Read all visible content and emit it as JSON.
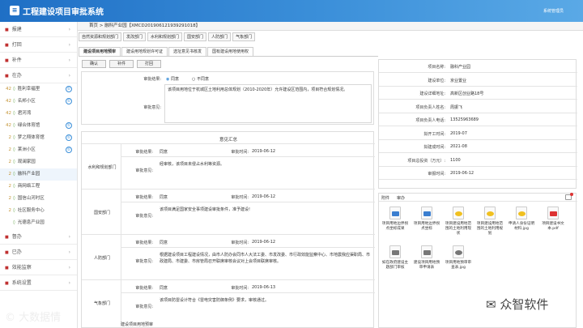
{
  "app": {
    "title": "工程建设项目审批系统",
    "logo": "≡",
    "user": "系统管理员"
  },
  "sidebar": {
    "items_top": [
      {
        "icon": "■",
        "label": "报建"
      },
      {
        "icon": "■",
        "label": "打回"
      },
      {
        "icon": "■",
        "label": "补件"
      },
      {
        "icon": "■",
        "label": "在办"
      }
    ],
    "sub": [
      {
        "n": "42",
        "label": "胜利幸福里",
        "badge": "①"
      },
      {
        "n": "42",
        "label": "名邦小区",
        "badge": "①"
      },
      {
        "n": "42",
        "label": "君河湾",
        "badge": ""
      },
      {
        "n": "42",
        "label": "绿合体育馆",
        "badge": "①"
      },
      {
        "n": "2",
        "label": "梦之翔体育馆",
        "badge": "①"
      },
      {
        "n": "2",
        "label": "莱洲小区",
        "badge": "①"
      },
      {
        "n": "2",
        "label": "观澜家园",
        "badge": ""
      },
      {
        "n": "2",
        "label": "融科产业园",
        "badge": ""
      },
      {
        "n": "2",
        "label": "商网络工程",
        "badge": ""
      },
      {
        "n": "2",
        "label": "国信山河时区",
        "badge": ""
      },
      {
        "n": "2",
        "label": "社区服务中心",
        "badge": ""
      },
      {
        "n": "",
        "label": "光德息产业园",
        "badge": ""
      }
    ],
    "items_bottom": [
      {
        "icon": "■",
        "label": "督办"
      },
      {
        "icon": "■",
        "label": "已办"
      },
      {
        "icon": "■",
        "label": "效能监察"
      },
      {
        "icon": "■",
        "label": "系统设置"
      }
    ]
  },
  "breadcrumb": "首页 > 融科产业园【XMCD20190612193929101​8】",
  "tabs": [
    "自然资源和规划部门",
    "发改部门",
    "水利和规划部门",
    "国安部门",
    "人防部门",
    "气象部门"
  ],
  "subtabs": [
    "建设项目用地预审",
    "建设用地规划许可证",
    "选址意见书核发",
    "国有建设用地使用权"
  ],
  "buttons": [
    "确认",
    "补件",
    "打回"
  ],
  "approval": {
    "result_label": "审批结果:",
    "opt_agree": "同意",
    "opt_disagree": "不同意",
    "opinion_label": "审批意见:",
    "opinion": "该项目用地位于杭城区土地利用总体规划（2010-2020年）允许建设区范围内，项目符合规划情况。"
  },
  "summary": {
    "title": "意见汇总",
    "rows": [
      {
        "dept": "水利和规划部门",
        "result": "同意",
        "date": "2019-06-12",
        "opinion": "经审核，该项目未侵占水利等资源。"
      },
      {
        "dept": "国安部门",
        "result": "同意",
        "date": "2019-06-12",
        "opinion": "该项目满足国家安全事项建设审批条件，准予建设!"
      },
      {
        "dept": "人防部门",
        "result": "同意",
        "date": "2019-06-12",
        "opinion": "根据建设项目工程建设情况，由市人防办会同市人大法工委、市发改委、市行政效能监察中心、市地震我应渠职局、市政建局、市建委、市房管局召开联席审核会议对上会项目联席审核。"
      },
      {
        "dept": "气象部门",
        "result": "同意",
        "date": "2019-06-13",
        "opinion": "该项目防雷设计符合《雷电灾害防御条例》要求，审核通过。"
      }
    ],
    "labels": {
      "result": "审批结果:",
      "date": "审批时间:",
      "opinion": "审批意见:"
    },
    "footer": "建设项目用地预审"
  },
  "info": [
    {
      "k": "项目名称:",
      "v": "融科产业园"
    },
    {
      "k": "建设单位:",
      "v": "京业置业"
    },
    {
      "k": "建设详细地址:",
      "v": "高新区创业路18号"
    },
    {
      "k": "项目负责人姓名:",
      "v": "周振飞"
    },
    {
      "k": "项目负责人电话:",
      "v": "13525963689"
    },
    {
      "k": "拟开工时间:",
      "v": "2019-07"
    },
    {
      "k": "拟建成时间:",
      "v": "2021-08"
    },
    {
      "k": "项目总投资（万元）:",
      "v": "1100"
    },
    {
      "k": "审报时间:",
      "v": "2019-06-12"
    }
  ],
  "attachments": {
    "tab1": "附件",
    "tab2": "审办",
    "files": [
      {
        "name": "项目用地边界拐点坐标成果",
        "icon": "doc",
        "color": "#3b7fd0"
      },
      {
        "name": "项目用地边界拐点坐标",
        "icon": "doc",
        "color": "#3b7fd0"
      },
      {
        "name": "项目建设用地范围的土地利用现状",
        "icon": "img",
        "color": "#f0c020"
      },
      {
        "name": "项目建设用地范围的土地利用规划",
        "icon": "img",
        "color": "#f0c020"
      },
      {
        "name": "申请人身份证明材料.jpg",
        "icon": "img",
        "color": "#f0c020"
      },
      {
        "name": "项目建设书文本.pdf",
        "icon": "pdf",
        "color": "#d33"
      },
      {
        "name": "如在政府建设主题部门审核",
        "icon": "doc",
        "color": "#777"
      },
      {
        "name": "建设项目用地预审申请表",
        "icon": "doc",
        "color": "#777"
      },
      {
        "name": "项目用地预审审查表.jpg",
        "icon": "img",
        "color": "#777"
      }
    ]
  },
  "watermarks": [
    "大数据情",
    "众智软件"
  ]
}
